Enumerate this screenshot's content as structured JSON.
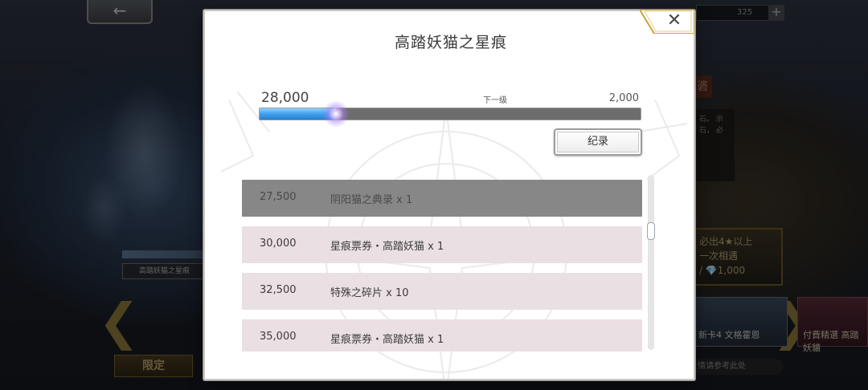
{
  "background": {
    "currency_value": "325",
    "currency_plus": "+",
    "back_arrow": "←",
    "side_banner_char": "碆",
    "side_text": "石。 示石， 必",
    "character_name": "高踏妖猫之星痕",
    "offer_line1": "必出4★以上",
    "offer_line2": "一次相遇",
    "offer_line3": "/ 💎1,000",
    "card1_label": "新卡4 文格霍恩",
    "card2_label": "付費精選 高踏妖貓",
    "hint_text": "情请参考此处",
    "limited_tab": "限定",
    "arrow_left": "❮",
    "arrow_right": "❯"
  },
  "dialog": {
    "title": "高踏妖猫之星痕",
    "close_symbol": "✕",
    "progress": {
      "current_points": "28,000",
      "next_label": "下一级",
      "next_value": "2,000",
      "fill_fraction": 0.2
    },
    "record_button": "纪录",
    "rewards": [
      {
        "points": "27,500",
        "item": "阴阳猫之典录 x 1",
        "claimed": true
      },
      {
        "points": "30,000",
        "item": "星痕票券・高踏妖猫 x 1",
        "claimed": false
      },
      {
        "points": "32,500",
        "item": "特殊之碎片 x 10",
        "claimed": false
      },
      {
        "points": "35,000",
        "item": "星痕票券・高踏妖猫 x 1",
        "claimed": false
      }
    ],
    "scroll_position": 0.3
  }
}
